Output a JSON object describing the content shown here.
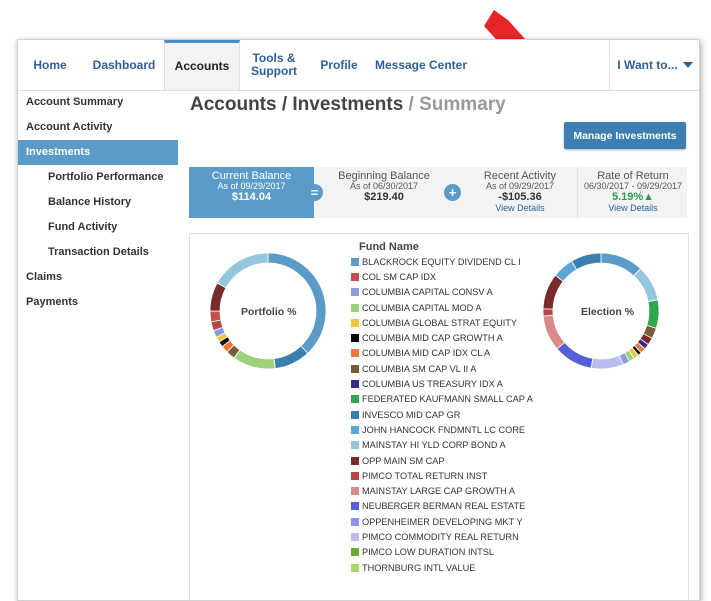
{
  "nav": {
    "home": "Home",
    "dashboard": "Dashboard",
    "accounts": "Accounts",
    "tools_line1": "Tools &",
    "tools_line2": "Support",
    "profile": "Profile",
    "message_center": "Message Center",
    "i_want": "I Want to..."
  },
  "sidebar": {
    "items": [
      {
        "label": "Account Summary"
      },
      {
        "label": "Account Activity"
      },
      {
        "label": "Investments"
      },
      {
        "label": "Portfolio Performance"
      },
      {
        "label": "Balance History"
      },
      {
        "label": "Fund Activity"
      },
      {
        "label": "Transaction Details"
      },
      {
        "label": "Claims"
      },
      {
        "label": "Payments"
      }
    ]
  },
  "page": {
    "title_main": "Accounts / Investments",
    "title_sep": " / ",
    "title_light": "Summary",
    "manage_button": "Manage Investments"
  },
  "summary": {
    "current": {
      "label": "Current Balance",
      "asof": "As of 09/29/2017",
      "value": "$114.04"
    },
    "equals_symbol": "=",
    "beginning": {
      "label": "Beginning Balance",
      "asof": "As of 06/30/2017",
      "value": "$219.40"
    },
    "plus_symbol": "+",
    "recent": {
      "label": "Recent Activity",
      "asof": "As of 09/29/2017",
      "value": "-$105.36",
      "details": "View Details"
    },
    "rate": {
      "label": "Rate of Return",
      "asof": "06/30/2017 - 09/29/2017",
      "value": "5.19%▲",
      "details": "View Details"
    }
  },
  "charts": {
    "portfolio_label": "Portfolio %",
    "election_label": "Election %",
    "legend_title": "Fund Name"
  },
  "funds": [
    {
      "name": "BLACKROCK EQUITY DIVIDEND CL I",
      "color": "#5b9bc8"
    },
    {
      "name": "COL SM CAP IDX",
      "color": "#c0504d"
    },
    {
      "name": "COLUMBIA CAPITAL CONSV A",
      "color": "#8a9be0"
    },
    {
      "name": "COLUMBIA CAPITAL MOD A",
      "color": "#9bd27a"
    },
    {
      "name": "COLUMBIA GLOBAL STRAT EQUITY",
      "color": "#f2c537"
    },
    {
      "name": "COLUMBIA MID CAP GROWTH A",
      "color": "#000000"
    },
    {
      "name": "COLUMBIA MID CAP IDX CL A",
      "color": "#e97b3a"
    },
    {
      "name": "COLUMBIA SM CAP VL II A",
      "color": "#7a5c3a"
    },
    {
      "name": "COLUMBIA US TREASURY IDX A",
      "color": "#3a2a8a"
    },
    {
      "name": "FEDERATED KAUFMANN SMALL CAP A",
      "color": "#2ea84a"
    },
    {
      "name": "INVESCO MID CAP GR",
      "color": "#3b7fb0"
    },
    {
      "name": "JOHN HANCOCK FNDMNTL LC CORE",
      "color": "#5aa6d6"
    },
    {
      "name": "MAINSTAY HI YLD CORP BOND A",
      "color": "#94c6dd"
    },
    {
      "name": "OPP MAIN SM CAP",
      "color": "#7b2a2a"
    },
    {
      "name": "PIMCO TOTAL RETURN INST",
      "color": "#b84545"
    },
    {
      "name": "MAINSTAY LARGE CAP GROWTH A",
      "color": "#d98a8a"
    },
    {
      "name": "NEUBERGER BERMAN REAL ESTATE",
      "color": "#5560d8"
    },
    {
      "name": "OPPENHEIMER DEVELOPING MKT Y",
      "color": "#8b94e8"
    },
    {
      "name": "PIMCO COMMODITY REAL RETURN",
      "color": "#b9bdf0"
    },
    {
      "name": "PIMCO LOW DURATION INTSL",
      "color": "#6aa832"
    },
    {
      "name": "THORNBURG INTL VALUE",
      "color": "#a6d86a"
    }
  ],
  "portfolio_segments": [
    {
      "fund": "BLACKROCK EQUITY DIVIDEND CL I",
      "pct": 38,
      "color": "#5b9bc8"
    },
    {
      "fund": "INVESCO MID CAP GR",
      "pct": 10,
      "color": "#3b7fb0"
    },
    {
      "fund": "COLUMBIA CAPITAL MOD A",
      "pct": 12,
      "color": "#9bd27a"
    },
    {
      "fund": "COLUMBIA SM CAP VL II A",
      "pct": 2.5,
      "color": "#7a5c3a"
    },
    {
      "fund": "COLUMBIA MID CAP IDX CL A",
      "pct": 2,
      "color": "#e97b3a"
    },
    {
      "fund": "COLUMBIA MID CAP GROWTH A",
      "pct": 1.5,
      "color": "#000000"
    },
    {
      "fund": "COLUMBIA GLOBAL STRAT EQUITY",
      "pct": 1.5,
      "color": "#f2c537"
    },
    {
      "fund": "COLUMBIA CAPITAL CONSV A",
      "pct": 2,
      "color": "#8a9be0"
    },
    {
      "fund": "PIMCO TOTAL RETURN INST",
      "pct": 2.5,
      "color": "#b84545"
    },
    {
      "fund": "COL SM CAP IDX",
      "pct": 3,
      "color": "#c0504d"
    },
    {
      "fund": "OPP MAIN SM CAP",
      "pct": 8,
      "color": "#7b2a2a"
    },
    {
      "fund": "MAINSTAY HI YLD CORP BOND A",
      "pct": 17,
      "color": "#94c6dd"
    }
  ],
  "election_segments": [
    {
      "fund": "BLACKROCK EQUITY DIVIDEND CL I",
      "pct": 12,
      "color": "#5b9bc8"
    },
    {
      "fund": "MAINSTAY HI YLD CORP BOND A",
      "pct": 10,
      "color": "#94c6dd"
    },
    {
      "fund": "FEDERATED KAUFMANN SMALL CAP A",
      "pct": 8,
      "color": "#2ea84a"
    },
    {
      "fund": "COLUMBIA SM CAP VL II A",
      "pct": 3,
      "color": "#7a5c3a"
    },
    {
      "fund": "OPP MAIN SM CAP",
      "pct": 2,
      "color": "#7b2a2a"
    },
    {
      "fund": "COLUMBIA US TREASURY IDX A",
      "pct": 1.5,
      "color": "#3a2a8a"
    },
    {
      "fund": "COLUMBIA MID CAP IDX CL A",
      "pct": 1.5,
      "color": "#e97b3a"
    },
    {
      "fund": "COLUMBIA MID CAP GROWTH A",
      "pct": 1,
      "color": "#000000"
    },
    {
      "fund": "COLUMBIA GLOBAL STRAT EQUITY",
      "pct": 1.5,
      "color": "#f2c537"
    },
    {
      "fund": "COLUMBIA CAPITAL MOD A",
      "pct": 1.5,
      "color": "#9bd27a"
    },
    {
      "fund": "COLUMBIA CAPITAL CONSV A",
      "pct": 2,
      "color": "#8a9be0"
    },
    {
      "fund": "PIMCO COMMODITY REAL RETURN",
      "pct": 9,
      "color": "#b9bdf0"
    },
    {
      "fund": "NEUBERGER BERMAN REAL ESTATE",
      "pct": 11,
      "color": "#5560d8"
    },
    {
      "fund": "MAINSTAY LARGE CAP GROWTH A",
      "pct": 10,
      "color": "#d98a8a"
    },
    {
      "fund": "PIMCO TOTAL RETURN INST",
      "pct": 2,
      "color": "#b84545"
    },
    {
      "fund": "OPP MAIN SM CAP",
      "pct": 10,
      "color": "#7b2a2a"
    },
    {
      "fund": "JOHN HANCOCK FNDMNTL LC CORE",
      "pct": 6,
      "color": "#5aa6d6"
    },
    {
      "fund": "INVESCO MID CAP GR",
      "pct": 8.5,
      "color": "#3b7fb0"
    }
  ],
  "colors": {
    "accent": "#5b9bc8",
    "button": "#3d7fb3",
    "arrow": "#e8262a",
    "link": "#2d5f9a"
  }
}
